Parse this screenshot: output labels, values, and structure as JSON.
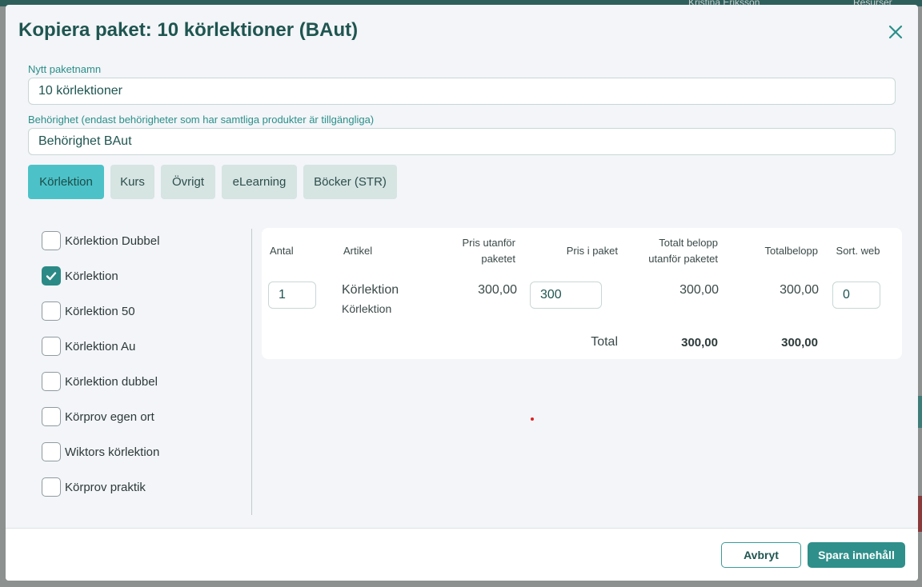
{
  "background": {
    "user_name": "Kristina Eriksson",
    "resources_label": "Resurser"
  },
  "dialog": {
    "title": "Kopiera paket: 10 körlektioner (BAut)",
    "package_name_label": "Nytt paketnamn",
    "package_name_value": "10 körlektioner",
    "permission_label": "Behörighet (endast behörigheter som har samtliga produkter är tillgängliga)",
    "permission_value": "Behörighet BAut"
  },
  "tabs": [
    {
      "label": "Körlektion",
      "active": true
    },
    {
      "label": "Kurs",
      "active": false
    },
    {
      "label": "Övrigt",
      "active": false
    },
    {
      "label": "eLearning",
      "active": false
    },
    {
      "label": "Böcker (STR)",
      "active": false
    }
  ],
  "products": [
    {
      "label": "Körlektion Dubbel",
      "checked": false
    },
    {
      "label": "Körlektion",
      "checked": true
    },
    {
      "label": "Körlektion 50",
      "checked": false
    },
    {
      "label": "Körlektion Au",
      "checked": false
    },
    {
      "label": "Körlektion dubbel",
      "checked": false
    },
    {
      "label": "Körprov egen ort",
      "checked": false
    },
    {
      "label": "Wiktors körlektion",
      "checked": false
    },
    {
      "label": "Körprov praktik",
      "checked": false
    }
  ],
  "table": {
    "headers": {
      "qty": "Antal",
      "article": "Artikel",
      "price_outside_1": "Pris utanför",
      "price_outside_2": "paketet",
      "price_in_package": "Pris i paket",
      "total_outside_1": "Totalt belopp",
      "total_outside_2": "utanför paketet",
      "total": "Totalbelopp",
      "sort_web": "Sort. web"
    },
    "row": {
      "qty": "1",
      "article_name": "Körlektion",
      "article_sub": "Körlektion",
      "price_outside": "300,00",
      "price_in_package": "300",
      "total_outside": "300,00",
      "total": "300,00",
      "sort_web": "0"
    },
    "footer": {
      "label": "Total",
      "total_outside": "300,00",
      "total": "300,00"
    }
  },
  "actions": {
    "cancel": "Avbryt",
    "save": "Spara innehåll"
  },
  "colors": {
    "accent": "#2f8f8a",
    "active_tab": "#4cc2c8",
    "title": "#1f5550"
  }
}
